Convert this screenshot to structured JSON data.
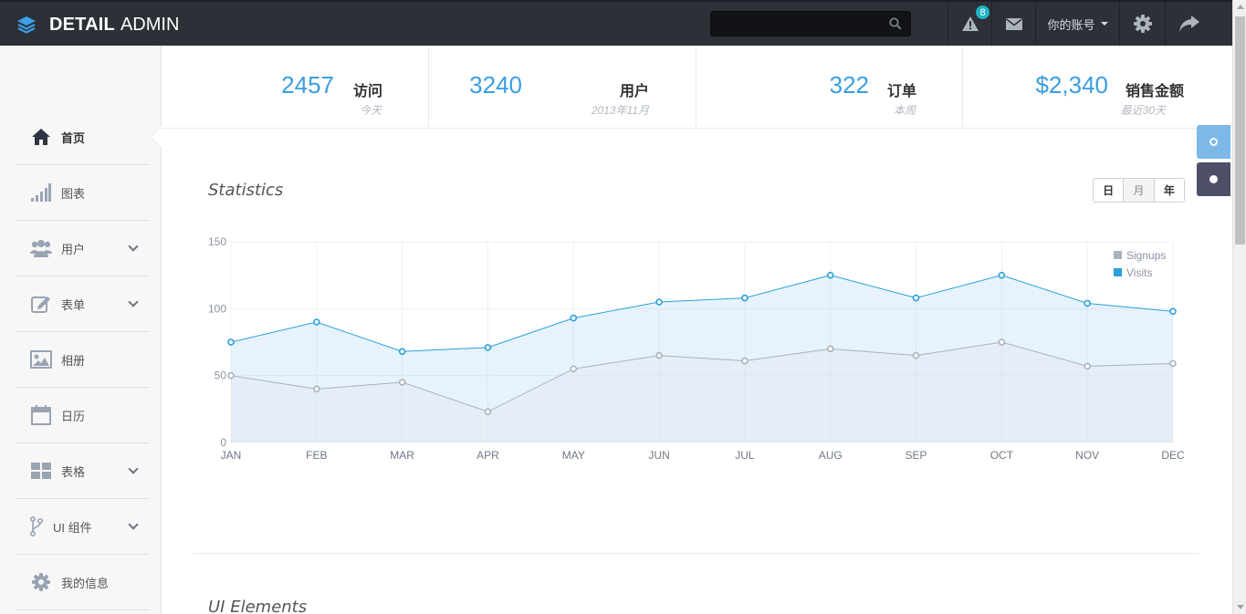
{
  "brand": {
    "strong": "DETAIL",
    "light": "ADMIN"
  },
  "topbar": {
    "search_placeholder": "",
    "alert_count": "8",
    "account_label": "你的账号",
    "icons": [
      "warning-icon",
      "mail-icon",
      "gear-icon",
      "share-icon"
    ]
  },
  "sidebar": {
    "items": [
      {
        "label": "首页",
        "icon": "home-icon",
        "expandable": false,
        "active": true
      },
      {
        "label": "图表",
        "icon": "bar-signal-icon",
        "expandable": false
      },
      {
        "label": "用户",
        "icon": "users-icon",
        "expandable": true
      },
      {
        "label": "表单",
        "icon": "edit-icon",
        "expandable": true
      },
      {
        "label": "相册",
        "icon": "image-icon",
        "expandable": false
      },
      {
        "label": "日历",
        "icon": "calendar-icon",
        "expandable": false
      },
      {
        "label": "表格",
        "icon": "grid-icon",
        "expandable": true
      },
      {
        "label": "UI 组件",
        "icon": "branch-icon",
        "expandable": true
      },
      {
        "label": "我的信息",
        "icon": "cog-icon",
        "expandable": false
      }
    ]
  },
  "stats": [
    {
      "value": "2457",
      "label": "访问",
      "sub": "今天"
    },
    {
      "value": "3240",
      "label": "用户",
      "sub": "2013年11月"
    },
    {
      "value": "322",
      "label": "订单",
      "sub": "本周"
    },
    {
      "value": "$2,340",
      "label": "销售金额",
      "sub": "最近30天"
    }
  ],
  "statistics": {
    "title": "Statistics",
    "range_tabs": [
      "日",
      "月",
      "年"
    ],
    "active_tab": 1
  },
  "ui_elements": {
    "title": "UI Elements"
  },
  "colors": {
    "accent": "#3a9ee1",
    "visits": "#2a9fd8",
    "signups": "#a9b1bc",
    "topbar": "#2c3037"
  },
  "chart_data": {
    "type": "area",
    "categories": [
      "JAN",
      "FEB",
      "MAR",
      "APR",
      "MAY",
      "JUN",
      "JUL",
      "AUG",
      "SEP",
      "OCT",
      "NOV",
      "DEC"
    ],
    "series": [
      {
        "name": "Signups",
        "values": [
          50,
          40,
          45,
          23,
          55,
          65,
          61,
          70,
          65,
          75,
          57,
          59
        ]
      },
      {
        "name": "Visits",
        "values": [
          75,
          90,
          68,
          71,
          93,
          105,
          108,
          125,
          108,
          125,
          104,
          98
        ]
      }
    ],
    "ylim": [
      0,
      150
    ],
    "yticks": [
      0,
      50,
      100,
      150
    ],
    "grid": true,
    "legend_position": "top-right"
  }
}
